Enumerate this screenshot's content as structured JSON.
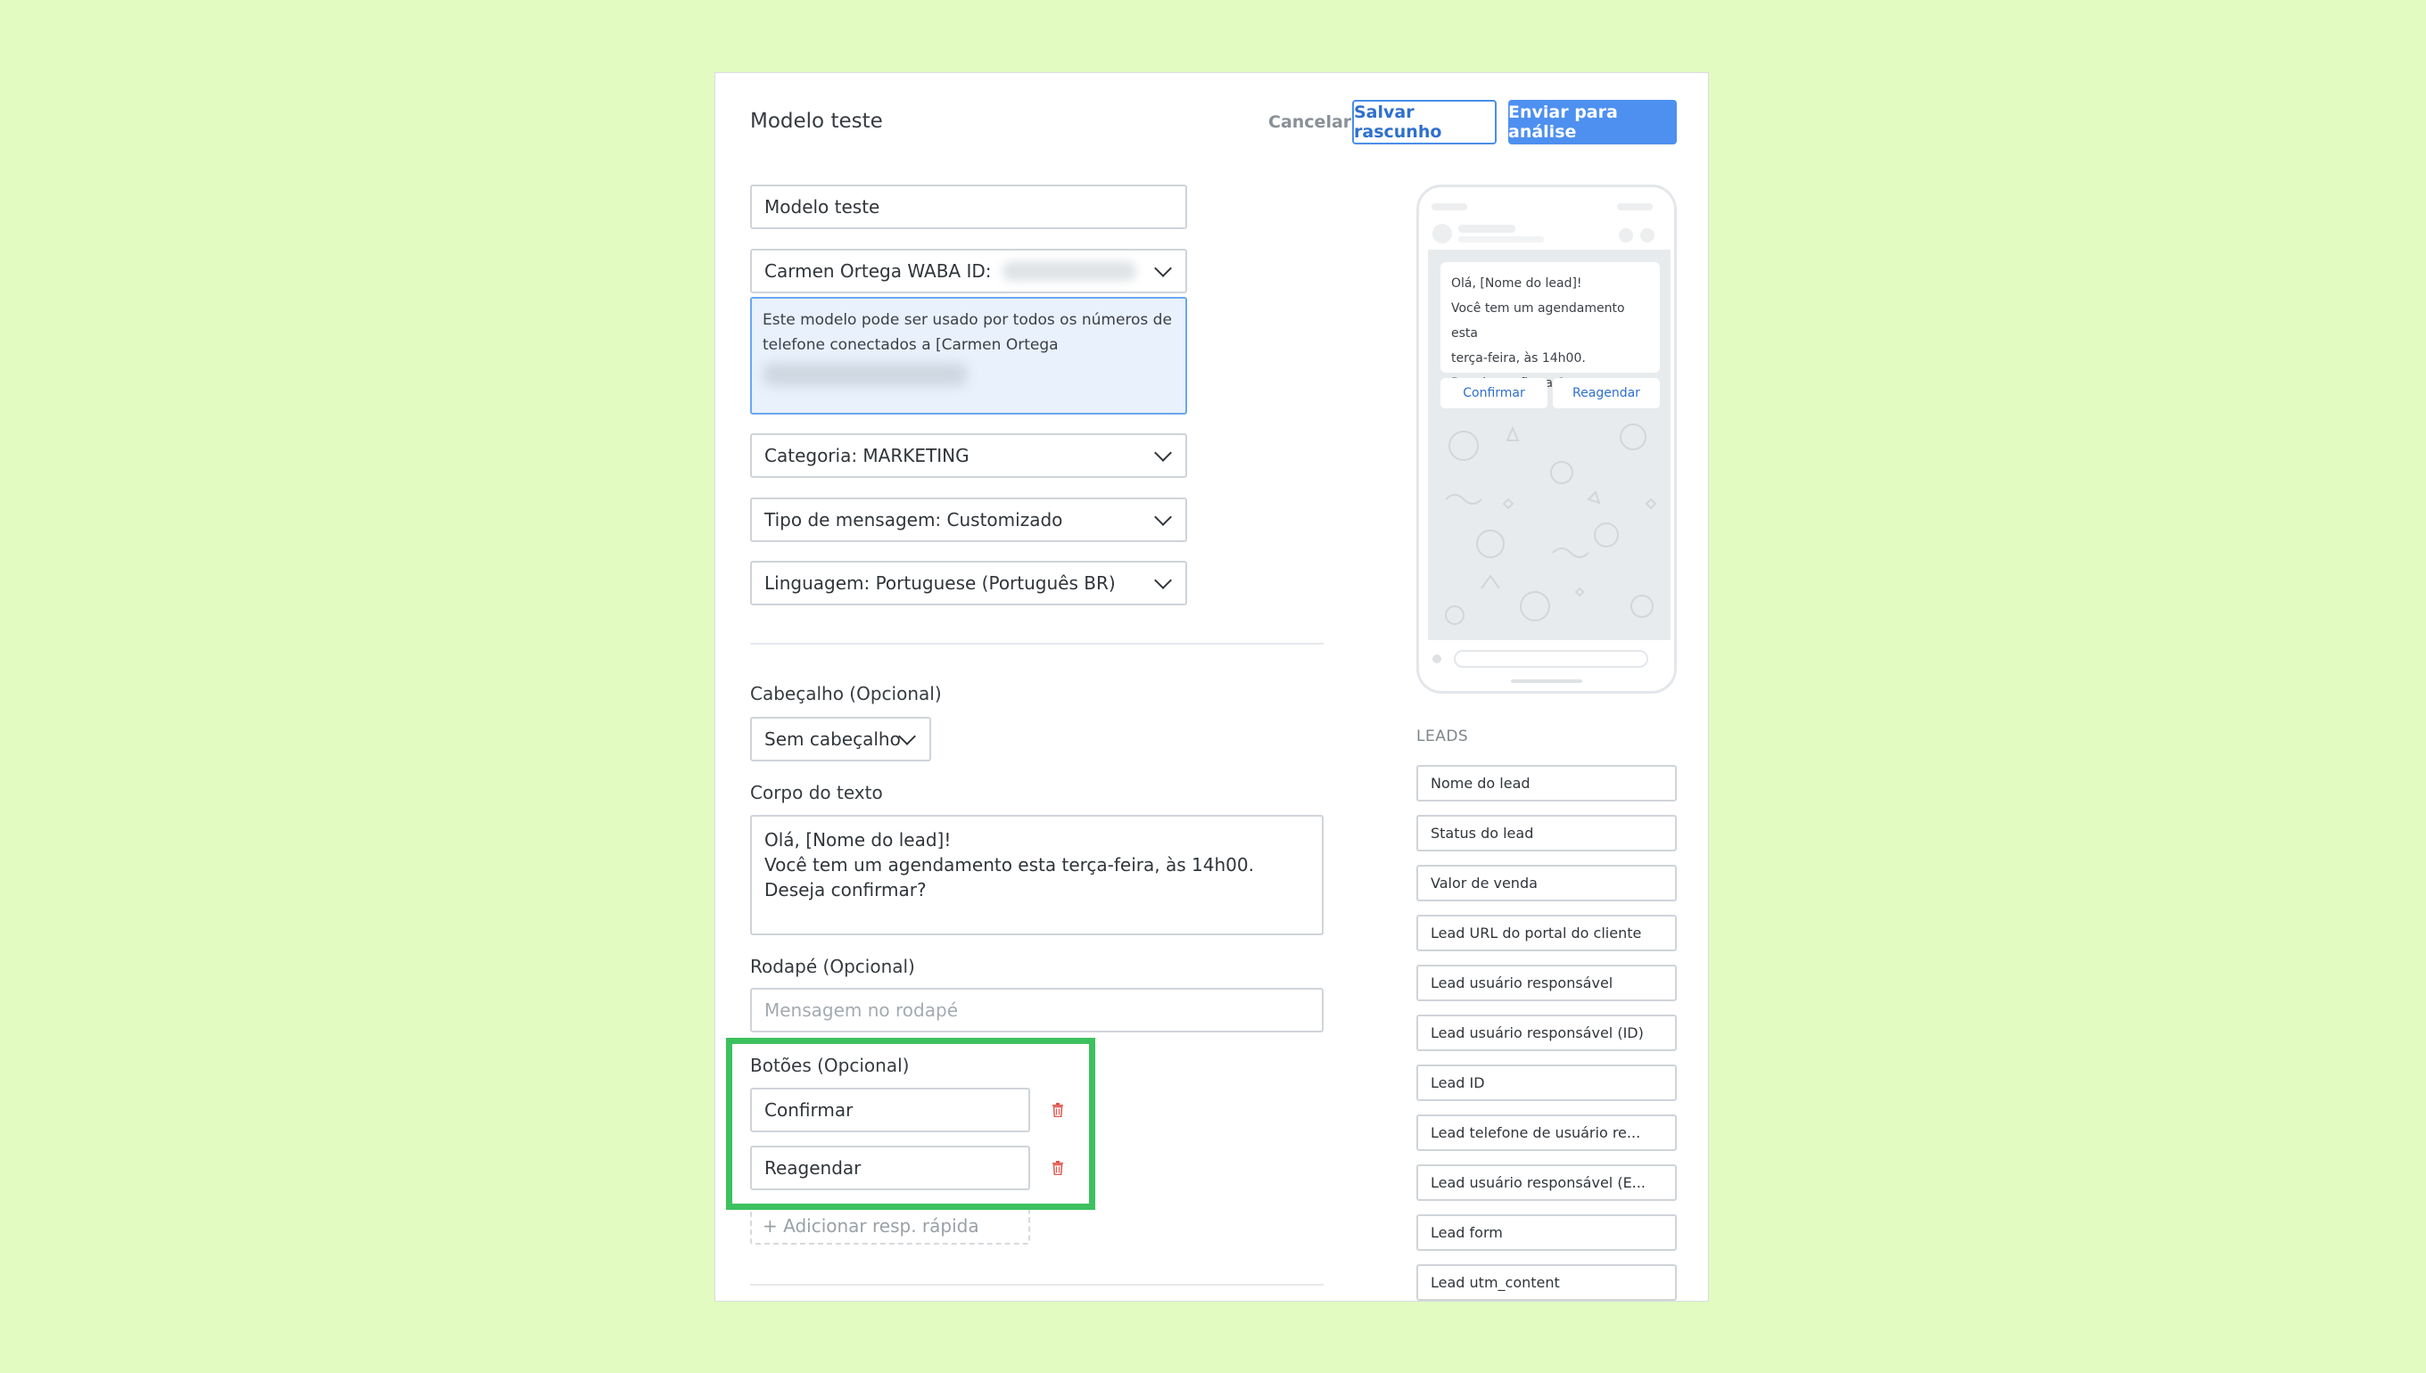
{
  "header": {
    "title": "Modelo teste",
    "cancel_label": "Cancelar",
    "draft_label": "Salvar rascunho",
    "submit_label": "Enviar para análise"
  },
  "form": {
    "name_value": "Modelo teste",
    "account_label": "Carmen Ortega WABA ID:",
    "account_info": "Este modelo pode ser usado por todos os números de telefone conectados a [Carmen Ortega",
    "category": "Categoria: MARKETING",
    "message_type": "Tipo de mensagem: Customizado",
    "language": "Linguagem: Portuguese (Português BR)"
  },
  "header_section": {
    "label": "Cabeçalho (Opcional)",
    "value": "Sem cabeçalho"
  },
  "body_section": {
    "label": "Corpo do texto",
    "lines": [
      "Olá, [Nome do lead]!",
      "Você tem um agendamento esta terça-feira, às 14h00.",
      "Deseja confirmar?"
    ]
  },
  "footer_section": {
    "label": "Rodapé (Opcional)",
    "placeholder": "Mensagem no rodapé"
  },
  "buttons_section": {
    "label": "Botões (Opcional)",
    "buttons": [
      "Confirmar",
      "Reagendar"
    ],
    "add_label": "+ Adicionar resp. rápida"
  },
  "preview": {
    "lines": [
      "Olá, [Nome do lead]!",
      "Você tem um agendamento esta",
      "terça-feira, às 14h00.",
      "Deseja confirmar?"
    ],
    "buttons": [
      "Confirmar",
      "Reagendar"
    ]
  },
  "leads": {
    "title": "LEADS",
    "items": [
      "Nome do lead",
      "Status do lead",
      "Valor de venda",
      "Lead URL do portal do cliente",
      "Lead usuário responsável",
      "Lead usuário responsável (ID)",
      "Lead ID",
      "Lead telefone de usuário re...",
      "Lead usuário responsável (E...",
      "Lead form",
      "Lead utm_content"
    ]
  },
  "colors": {
    "background": "#e1fbc1",
    "primary": "#4d90f0",
    "highlight": "#3dc15f",
    "delete": "#e2564f"
  }
}
